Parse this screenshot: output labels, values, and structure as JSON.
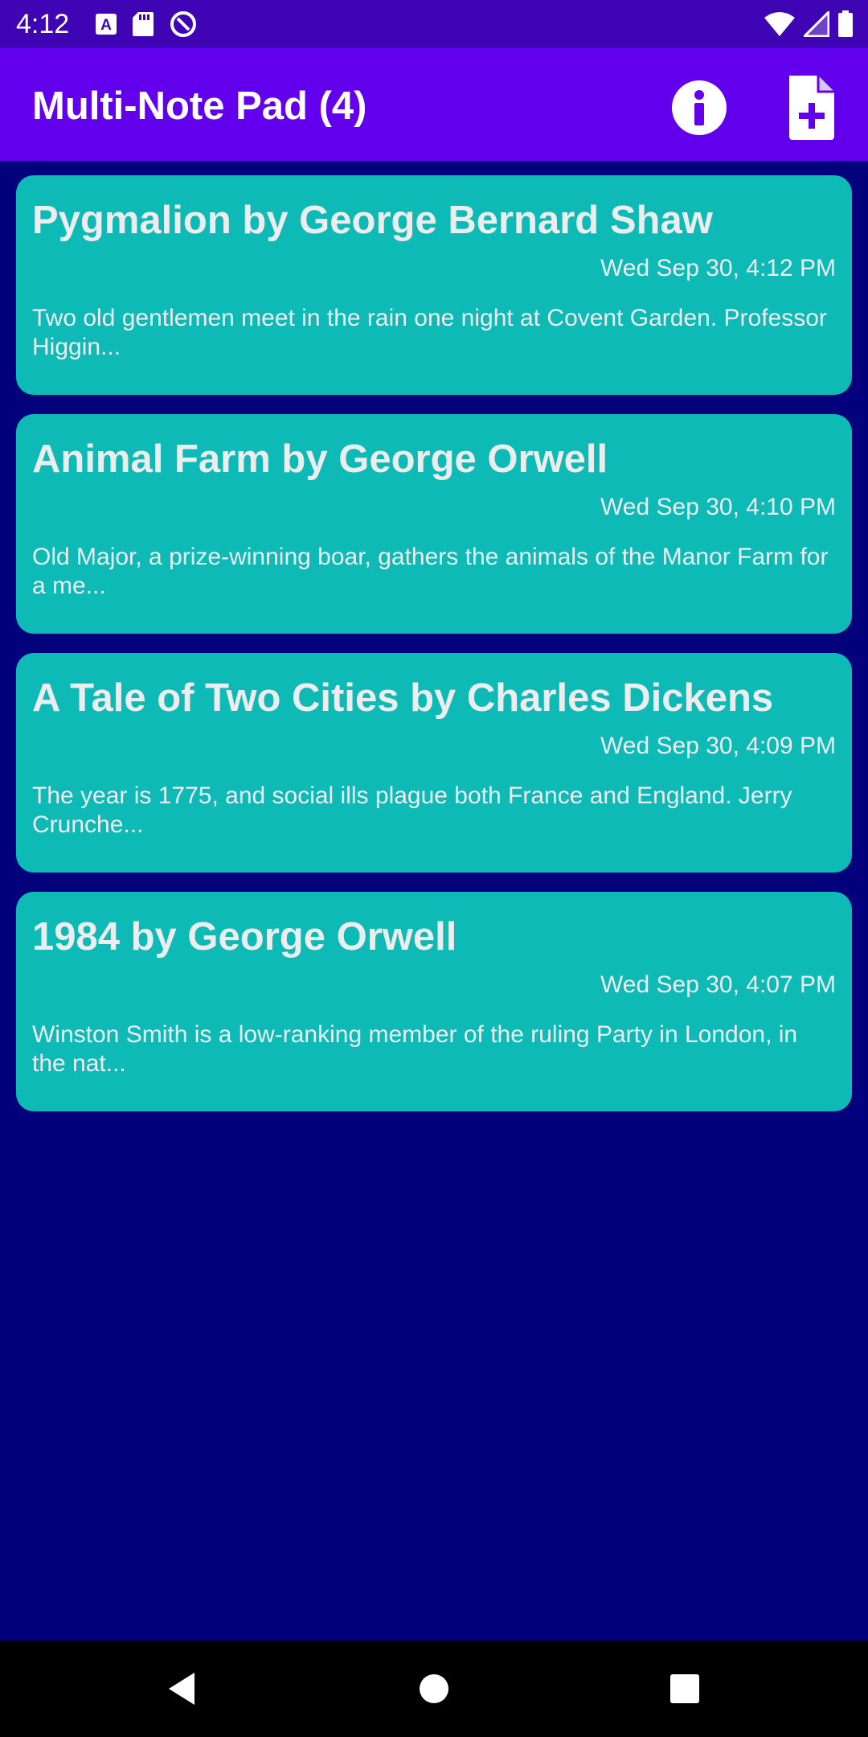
{
  "status_bar": {
    "time": "4:12",
    "left_icons": [
      "a-box-icon",
      "sd-card-icon",
      "data-saver-icon"
    ],
    "right_icons": [
      "wifi-icon",
      "cell-signal-icon",
      "battery-icon"
    ]
  },
  "app_bar": {
    "title": "Multi-Note Pad (4)",
    "actions": [
      "info-icon",
      "add-note-icon"
    ]
  },
  "notes": [
    {
      "title": "Pygmalion by George Bernard Shaw",
      "date": "Wed Sep 30, 4:12 PM",
      "preview": "Two old gentlemen meet in the rain one night at Covent Garden. Professor Higgin..."
    },
    {
      "title": "Animal Farm by George Orwell",
      "date": "Wed Sep 30, 4:10 PM",
      "preview": "Old Major, a prize-winning boar, gathers the animals of the Manor Farm for a me..."
    },
    {
      "title": "A Tale of Two Cities by Charles Dickens",
      "date": "Wed Sep 30, 4:09 PM",
      "preview": "The year is 1775, and social ills plague both France and England. Jerry Crunche..."
    },
    {
      "title": "1984 by George Orwell",
      "date": "Wed Sep 30, 4:07 PM",
      "preview": "Winston Smith is a low-ranking member of the ruling Party in London, in the nat..."
    }
  ],
  "nav_bar": {
    "buttons": [
      "back-icon",
      "home-icon",
      "recents-icon"
    ]
  },
  "colors": {
    "status_bar": "#3F05B5",
    "app_bar": "#6200EE",
    "background": "#02007A",
    "card": "#0DBAB6",
    "card_text": "#EDEDED"
  }
}
